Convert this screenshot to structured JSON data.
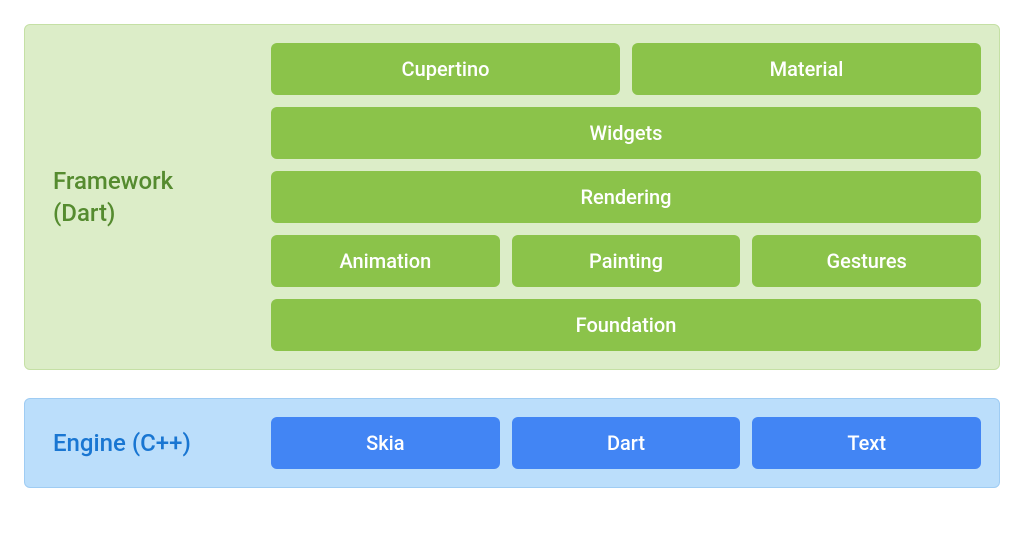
{
  "framework": {
    "label": "Framework\n(Dart)",
    "rows": [
      [
        "Cupertino",
        "Material"
      ],
      [
        "Widgets"
      ],
      [
        "Rendering"
      ],
      [
        "Animation",
        "Painting",
        "Gestures"
      ],
      [
        "Foundation"
      ]
    ]
  },
  "engine": {
    "label": "Engine (C++)",
    "rows": [
      [
        "Skia",
        "Dart",
        "Text"
      ]
    ]
  }
}
